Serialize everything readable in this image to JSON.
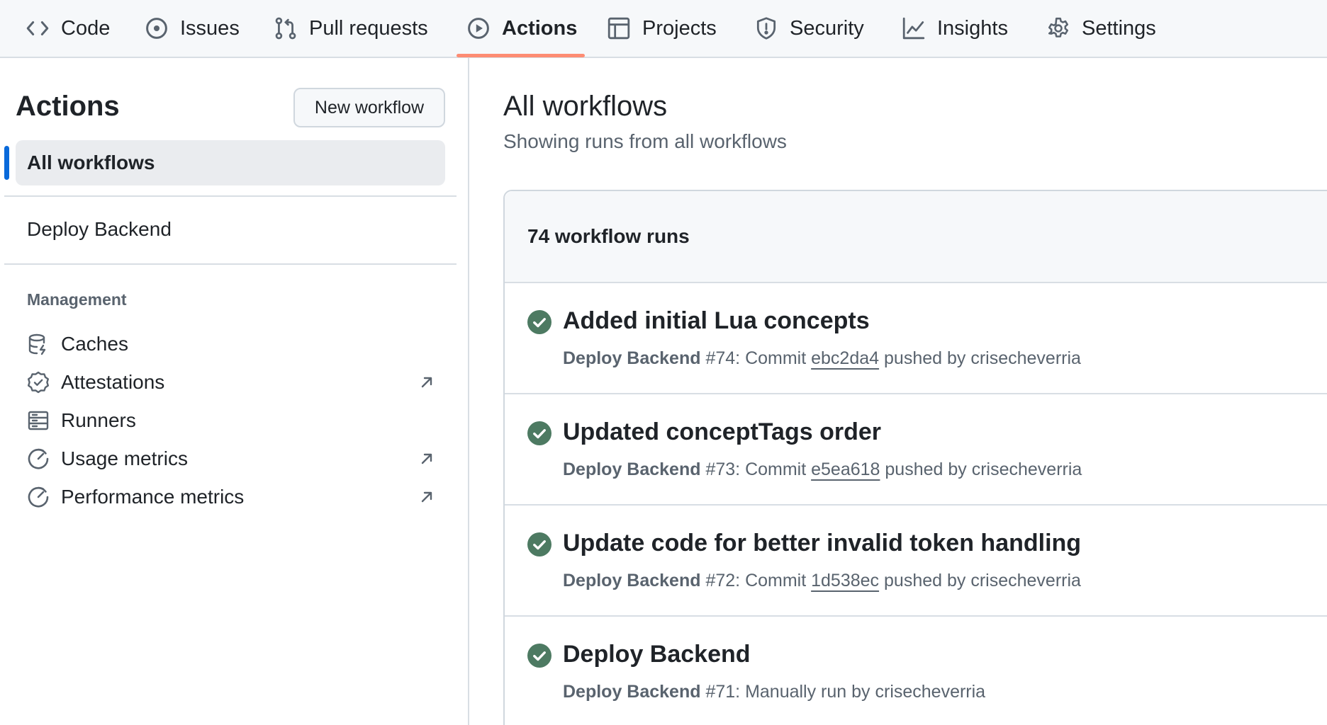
{
  "tabs": [
    {
      "label": "Code",
      "icon": "code-icon"
    },
    {
      "label": "Issues",
      "icon": "issue-opened-icon"
    },
    {
      "label": "Pull requests",
      "icon": "git-pull-request-icon"
    },
    {
      "label": "Actions",
      "icon": "play-icon",
      "active": true
    },
    {
      "label": "Projects",
      "icon": "table-icon"
    },
    {
      "label": "Security",
      "icon": "shield-icon"
    },
    {
      "label": "Insights",
      "icon": "graph-icon"
    },
    {
      "label": "Settings",
      "icon": "gear-icon"
    }
  ],
  "sidebar": {
    "title": "Actions",
    "new_workflow_label": "New workflow",
    "all_workflows_label": "All workflows",
    "workflows": [
      {
        "label": "Deploy Backend"
      }
    ],
    "management_heading": "Management",
    "management_items": [
      {
        "label": "Caches",
        "icon": "database-icon",
        "external": false
      },
      {
        "label": "Attestations",
        "icon": "verified-icon",
        "external": true
      },
      {
        "label": "Runners",
        "icon": "server-icon",
        "external": false
      },
      {
        "label": "Usage metrics",
        "icon": "meter-icon",
        "external": true
      },
      {
        "label": "Performance metrics",
        "icon": "meter-icon",
        "external": true
      }
    ]
  },
  "main": {
    "title": "All workflows",
    "subtitle": "Showing runs from all workflows",
    "runs_count": "74 workflow runs",
    "runs": [
      {
        "title": "Added initial Lua concepts",
        "workflow": "Deploy Backend",
        "meta_pre": " #74: Commit ",
        "sha": "ebc2da4",
        "meta_post": " pushed by crisecheverria",
        "status": "success"
      },
      {
        "title": "Updated conceptTags order",
        "workflow": "Deploy Backend",
        "meta_pre": " #73: Commit ",
        "sha": "e5ea618",
        "meta_post": " pushed by crisecheverria",
        "status": "success"
      },
      {
        "title": "Update code for better invalid token handling",
        "workflow": "Deploy Backend",
        "meta_pre": " #72: Commit ",
        "sha": "1d538ec",
        "meta_post": " pushed by crisecheverria",
        "status": "success"
      },
      {
        "title": "Deploy Backend",
        "workflow": "Deploy Backend",
        "meta_pre": " #71: Manually run by crisecheverria",
        "sha": "",
        "meta_post": "",
        "status": "success"
      }
    ]
  },
  "colors": {
    "accent_blue": "#0969da",
    "tab_underline": "#fd8c73",
    "success_green": "#4d7a62",
    "muted_text": "#59636e"
  }
}
